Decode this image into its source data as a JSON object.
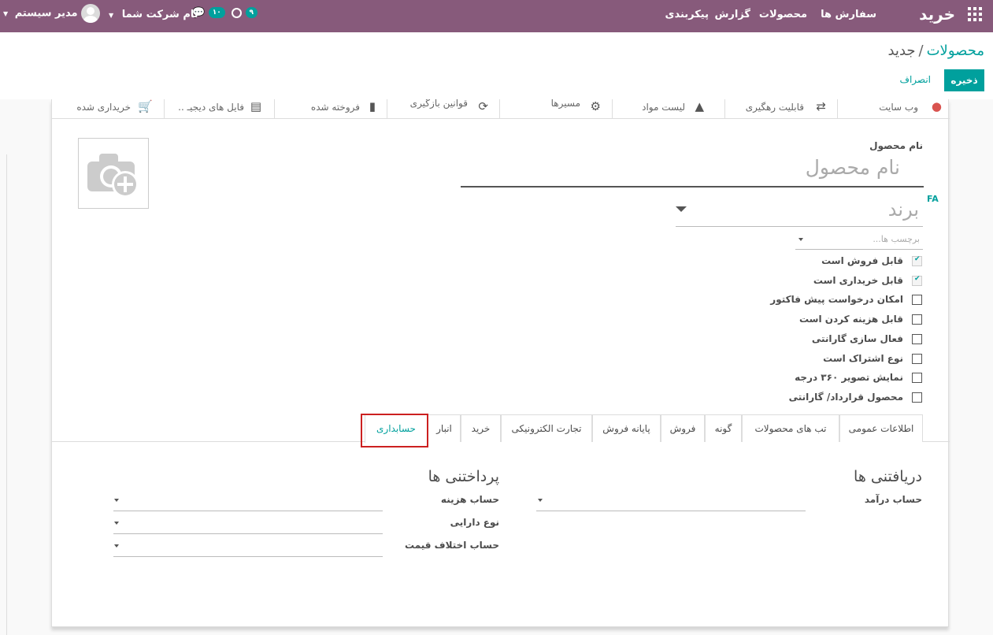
{
  "navbar": {
    "brand": "خرید",
    "menu": [
      "سفارش ها",
      "محصولات",
      "گزارش",
      "پیکربندی"
    ],
    "activity_count": "۹",
    "messages_count": "۱۰",
    "company": "نام شرکت شما",
    "user": "مدیر سیستم"
  },
  "breadcrumb": {
    "parent": "محصولات",
    "separator": "/",
    "current": "جدید"
  },
  "buttons": {
    "save": "ذخیره",
    "discard": "انصراف"
  },
  "smart_buttons": [
    {
      "label": "وب سایت",
      "icon": "globe-icon"
    },
    {
      "label": "قابلیت رهگیری",
      "icon": "exchange-icon"
    },
    {
      "label": "لیست مواد",
      "icon": "flask-icon"
    },
    {
      "label": "مسیرها",
      "icon": "cogs-icon"
    },
    {
      "label": "قوانین بازگیری",
      "icon": "refresh-icon"
    },
    {
      "label": "فروخته شده",
      "icon": "bar-chart-icon"
    },
    {
      "label": "فایل های دیجیـ ..",
      "icon": "file-text-icon"
    },
    {
      "label": "خریداری شده",
      "icon": "cart-icon"
    }
  ],
  "product": {
    "name_label": "نام محصول",
    "name_placeholder": "نام محصول",
    "brand_placeholder": "برند",
    "tags_placeholder": "برچسب ها...",
    "lang": "FA"
  },
  "checkboxes": [
    {
      "label": "قابل فروش است",
      "checked": true
    },
    {
      "label": "قابل خریداری است",
      "checked": true
    },
    {
      "label": "امکان درخواست پیش فاکتور",
      "checked": false
    },
    {
      "label": "قابل هزینه کردن است",
      "checked": false
    },
    {
      "label": "فعال سازی گارانتی",
      "checked": false
    },
    {
      "label": "نوع اشتراک است",
      "checked": false
    },
    {
      "label": "نمایش تصویر ۳۶۰ درجه",
      "checked": false
    },
    {
      "label": "محصول قرارداد/ گارانتی",
      "checked": false
    }
  ],
  "tabs": [
    "اطلاعات عمومی",
    "تب های محصولات",
    "گونه",
    "فروش",
    "پایانه فروش",
    "تجارت الکترونیکی",
    "خرید",
    "انبار",
    "حسابداری"
  ],
  "active_tab": "حسابداری",
  "accounting": {
    "receivables_title": "دریافتنی ها",
    "income_account": "حساب درآمد",
    "payables_title": "پرداختنی ها",
    "expense_account": "حساب هزینه",
    "asset_type": "نوع دارایی",
    "price_difference_account": "حساب اختلاف قیمت"
  },
  "colors": {
    "navbar": "#875a7b",
    "accent": "#00a09d",
    "highlight": "#cc2020"
  }
}
